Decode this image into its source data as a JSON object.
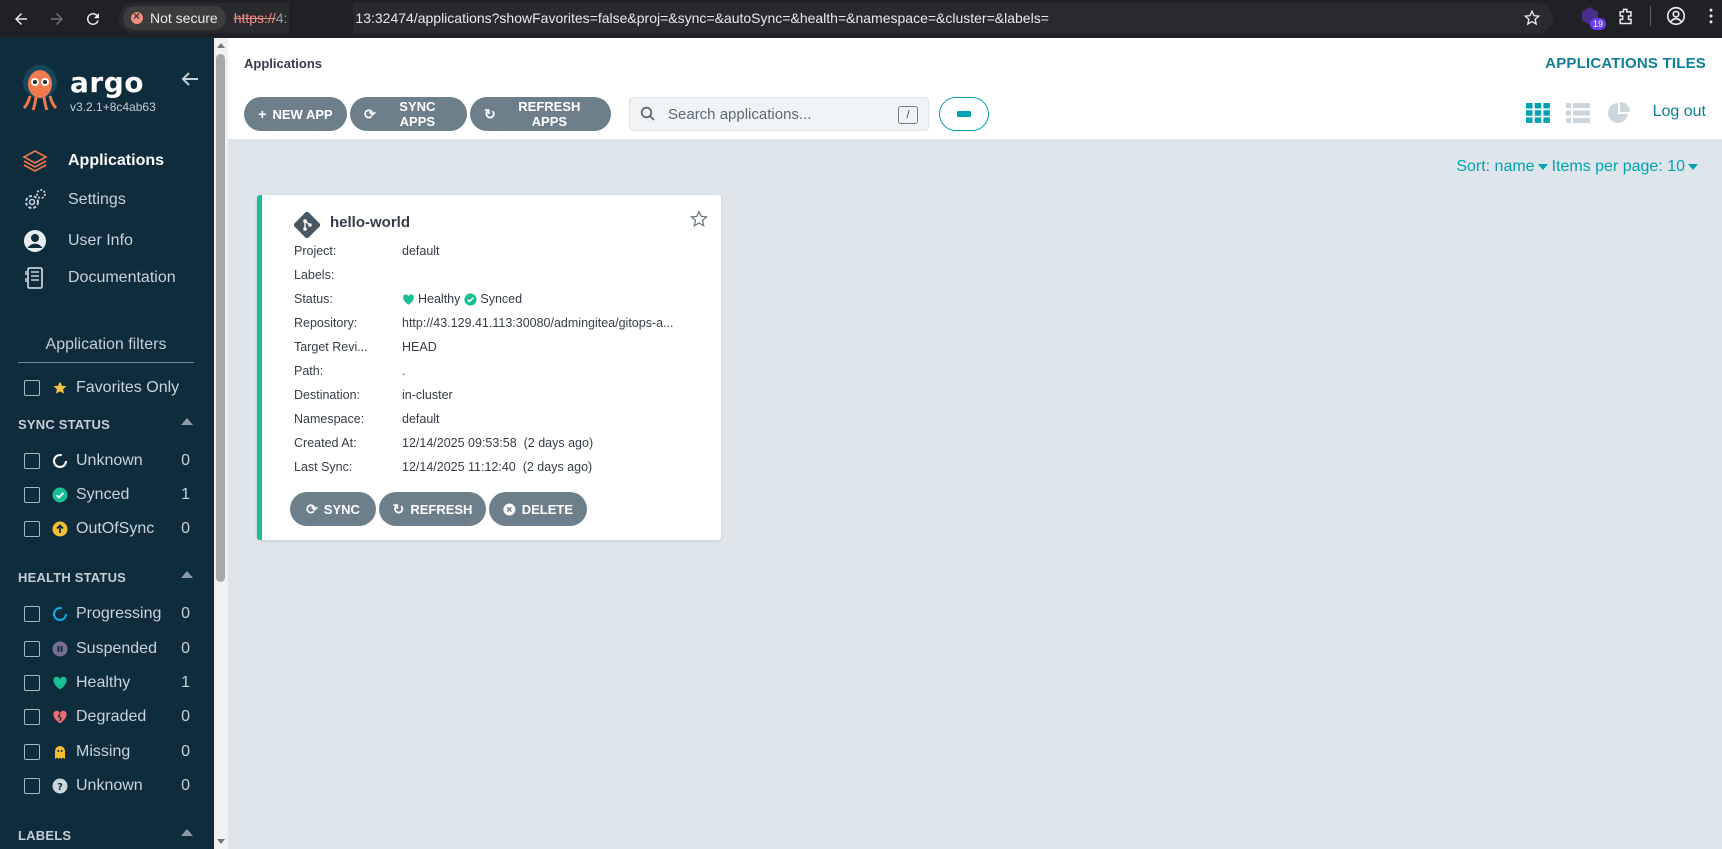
{
  "browser": {
    "security_label": "Not secure",
    "url_scheme": "https://",
    "url_host_prefix": "4:",
    "url_rest": "13:32474/applications?showFavorites=false&proj=&sync=&autoSync=&health=&namespace=&cluster=&labels=",
    "extension_badge": "19"
  },
  "sidebar": {
    "brand": "argo",
    "version": "v3.2.1+8c4ab63",
    "nav": [
      {
        "label": "Applications"
      },
      {
        "label": "Settings"
      },
      {
        "label": "User Info"
      },
      {
        "label": "Documentation"
      }
    ],
    "filters_title": "Application filters",
    "favorites_label": "Favorites Only",
    "sync_status": {
      "title": "SYNC STATUS",
      "items": [
        {
          "label": "Unknown",
          "count": "0"
        },
        {
          "label": "Synced",
          "count": "1"
        },
        {
          "label": "OutOfSync",
          "count": "0"
        }
      ]
    },
    "health_status": {
      "title": "HEALTH STATUS",
      "items": [
        {
          "label": "Progressing",
          "count": "0"
        },
        {
          "label": "Suspended",
          "count": "0"
        },
        {
          "label": "Healthy",
          "count": "1"
        },
        {
          "label": "Degraded",
          "count": "0"
        },
        {
          "label": "Missing",
          "count": "0"
        },
        {
          "label": "Unknown",
          "count": "0"
        }
      ]
    },
    "labels_title": "LABELS"
  },
  "header": {
    "page_title": "Applications",
    "view_title": "APPLICATIONS TILES"
  },
  "toolbar": {
    "new_app": "NEW APP",
    "sync_apps": "SYNC APPS",
    "refresh_apps": "REFRESH APPS",
    "search_placeholder": "Search applications...",
    "search_shortcut": "/",
    "logout": "Log out"
  },
  "sort": {
    "sort_label": "Sort: name",
    "per_page_label": "Items per page: 10"
  },
  "app": {
    "name": "hello-world",
    "fields": [
      {
        "key": "Project:",
        "value": "default"
      },
      {
        "key": "Labels:",
        "value": ""
      },
      {
        "key": "Status:",
        "health": "Healthy",
        "sync": "Synced"
      },
      {
        "key": "Repository:",
        "value": "http://43.129.41.113:30080/admingitea/gitops-a..."
      },
      {
        "key": "Target Revi...",
        "value": "HEAD"
      },
      {
        "key": "Path:",
        "value": "."
      },
      {
        "key": "Destination:",
        "value": "in-cluster"
      },
      {
        "key": "Namespace:",
        "value": "default"
      },
      {
        "key": "Created At:",
        "value": "12/14/2025 09:53:58  (2 days ago)"
      },
      {
        "key": "Last Sync:",
        "value": "12/14/2025 11:12:40  (2 days ago)"
      }
    ],
    "actions": {
      "sync": "SYNC",
      "refresh": "REFRESH",
      "delete": "DELETE"
    }
  },
  "colors": {
    "sidebar_bg": "#0e2c3c",
    "accent": "#00a2b3",
    "healthy": "#18be94",
    "button_bg": "#6d7f8b"
  }
}
